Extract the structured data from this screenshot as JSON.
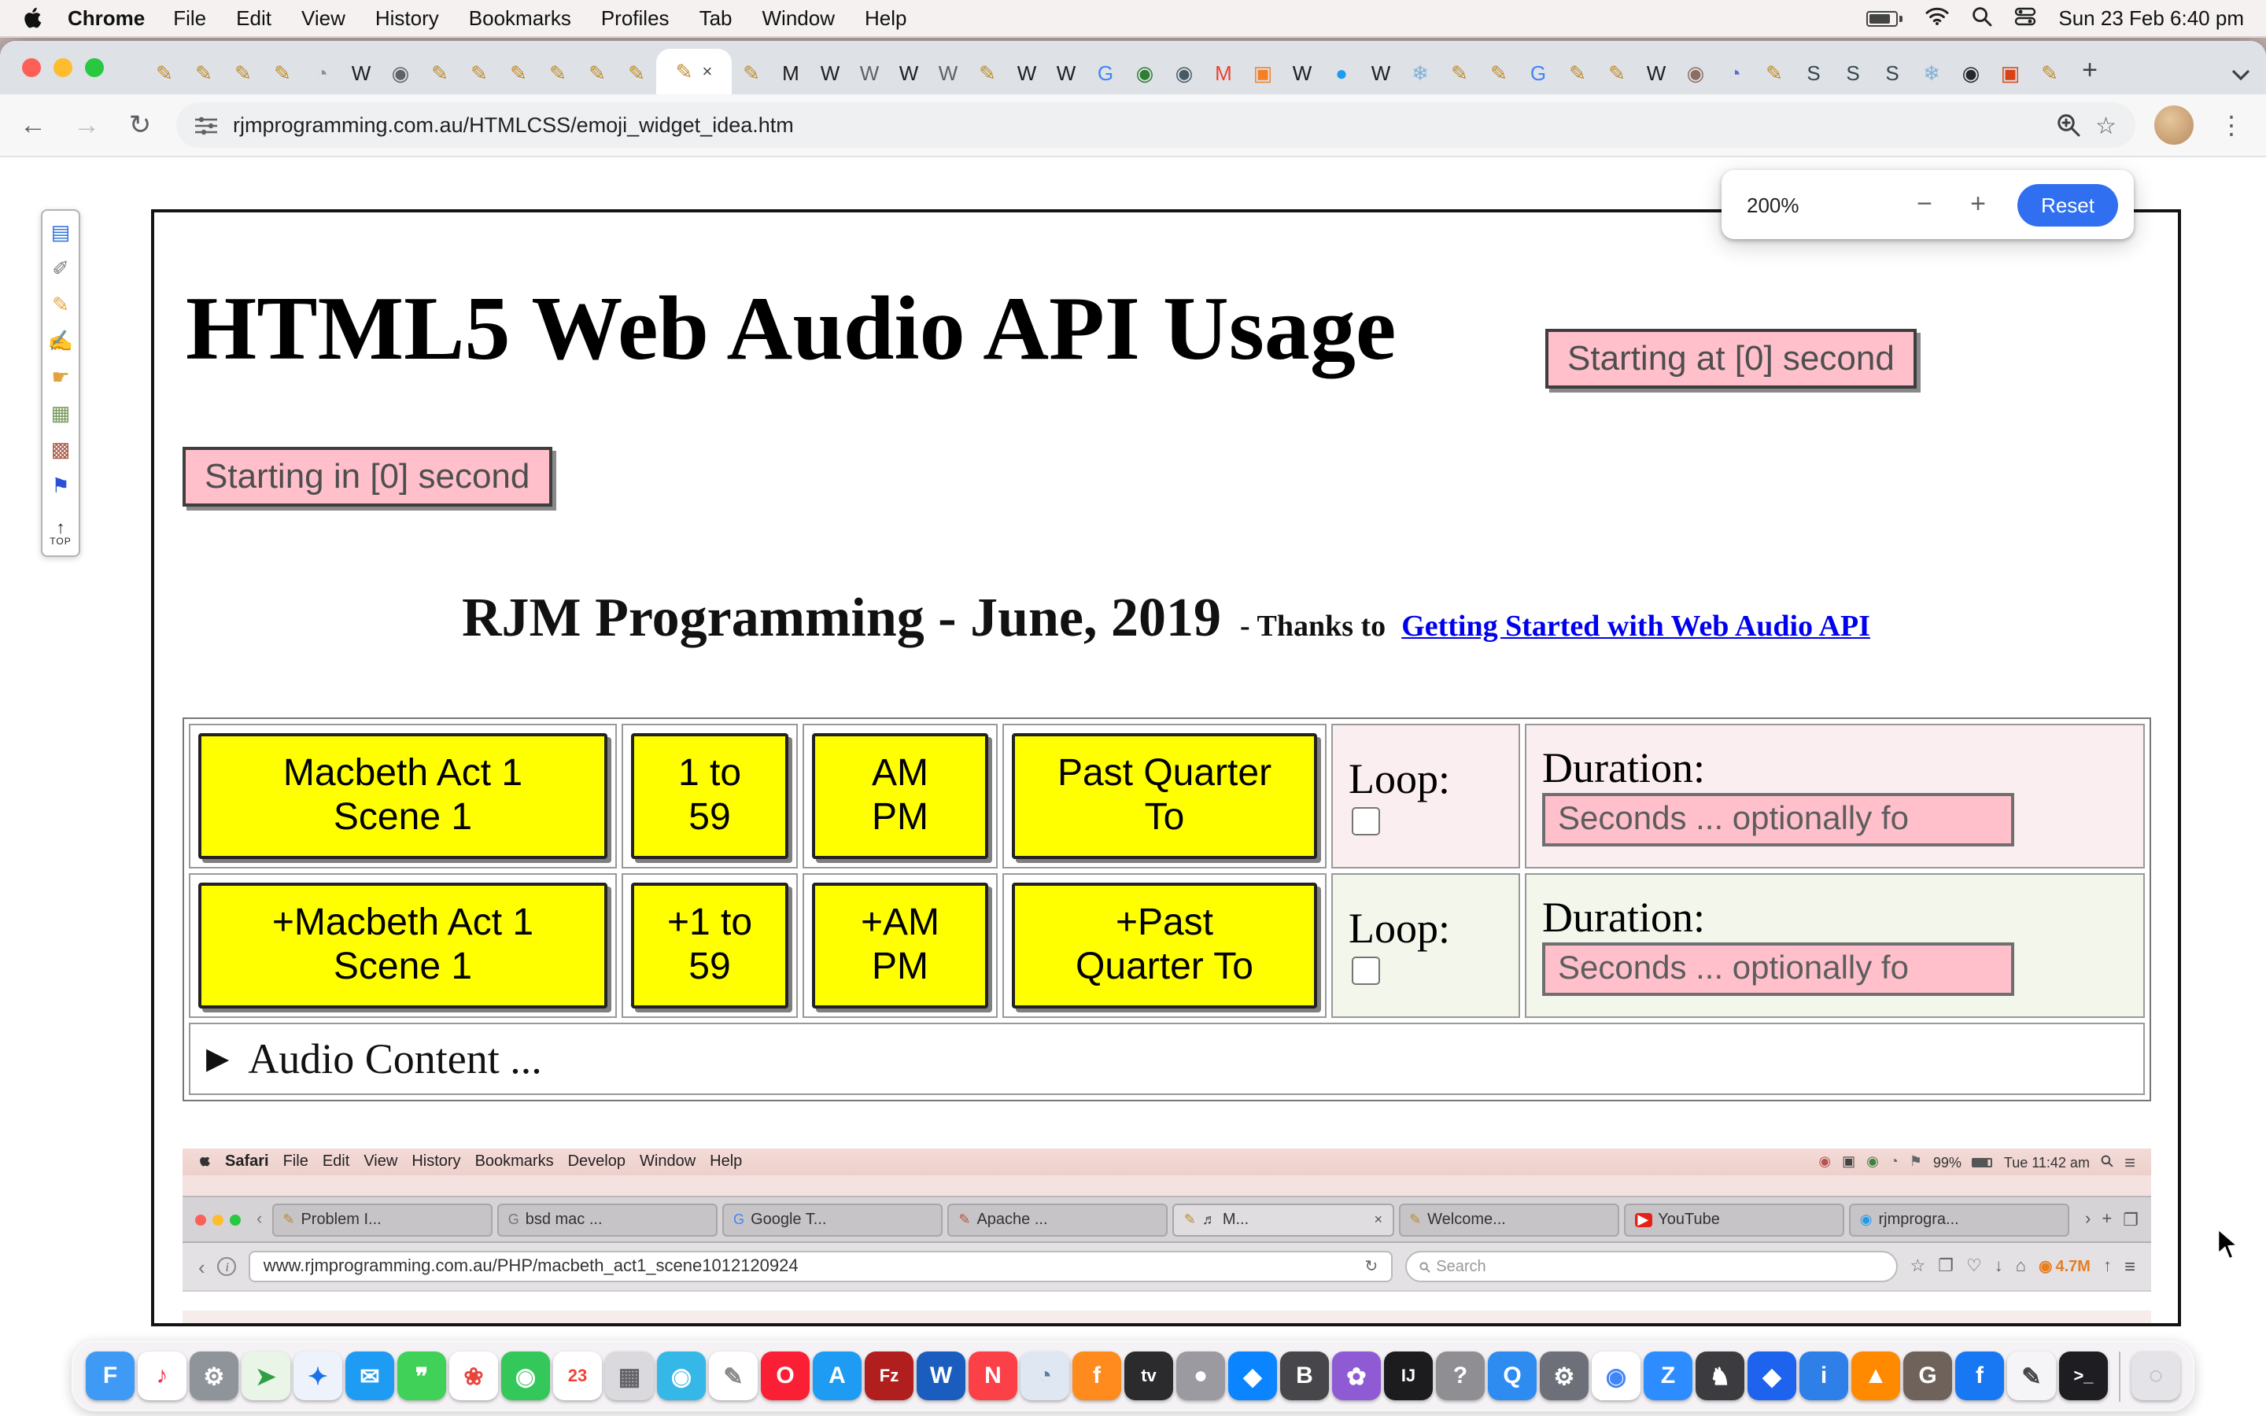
{
  "menubar": {
    "app": "Chrome",
    "items": [
      "File",
      "Edit",
      "View",
      "History",
      "Bookmarks",
      "Profiles",
      "Tab",
      "Window",
      "Help"
    ],
    "clock": "Sun 23 Feb 6:40 pm"
  },
  "tabstrip": {
    "favicons_before": [
      {
        "g": "✎",
        "c": "#c08a28"
      },
      {
        "g": "✎",
        "c": "#c08a28"
      },
      {
        "g": "✎",
        "c": "#c08a28"
      },
      {
        "g": "✎",
        "c": "#c08a28"
      },
      {
        "g": "◔",
        "c": "#8a8f98"
      },
      {
        "g": "W",
        "c": "#202124"
      },
      {
        "g": "◉",
        "c": "#5f6368"
      },
      {
        "g": "✎",
        "c": "#c08a28"
      },
      {
        "g": "✎",
        "c": "#c08a28"
      },
      {
        "g": "✎",
        "c": "#c08a28"
      },
      {
        "g": "✎",
        "c": "#c08a28"
      },
      {
        "g": "✎",
        "c": "#c08a28"
      },
      {
        "g": "✎",
        "c": "#c08a28"
      }
    ],
    "active": {
      "g": "✎",
      "c": "#c08a28"
    },
    "close": "×",
    "favicons_after": [
      {
        "g": "✎",
        "c": "#c08a28"
      },
      {
        "g": "M",
        "c": "#1a1a1a"
      },
      {
        "g": "W",
        "c": "#202124"
      },
      {
        "g": "W",
        "c": "#5f6368"
      },
      {
        "g": "W",
        "c": "#202124"
      },
      {
        "g": "W",
        "c": "#5f6368"
      },
      {
        "g": "✎",
        "c": "#c08a28"
      },
      {
        "g": "W",
        "c": "#202124"
      },
      {
        "g": "W",
        "c": "#202124"
      },
      {
        "g": "G",
        "c": "#4285f4"
      },
      {
        "g": "◉",
        "c": "#2e7d32"
      },
      {
        "g": "◉",
        "c": "#455a64"
      },
      {
        "g": "M",
        "c": "#ea4335"
      },
      {
        "g": "▣",
        "c": "#f48024"
      },
      {
        "g": "W",
        "c": "#202124"
      },
      {
        "g": "●",
        "c": "#1d9bf0"
      },
      {
        "g": "W",
        "c": "#202124"
      },
      {
        "g": "❄",
        "c": "#7fb1d8"
      },
      {
        "g": "✎",
        "c": "#c08a28"
      },
      {
        "g": "✎",
        "c": "#c08a28"
      },
      {
        "g": "G",
        "c": "#4285f4"
      },
      {
        "g": "✎",
        "c": "#c08a28"
      },
      {
        "g": "✎",
        "c": "#c08a28"
      },
      {
        "g": "W",
        "c": "#202124"
      },
      {
        "g": "◉",
        "c": "#8d6e63"
      },
      {
        "g": "◔",
        "c": "#5c6bc0"
      },
      {
        "g": "✎",
        "c": "#c08a28"
      },
      {
        "g": "S",
        "c": "#37474f"
      },
      {
        "g": "S",
        "c": "#37474f"
      },
      {
        "g": "S",
        "c": "#37474f"
      },
      {
        "g": "❄",
        "c": "#7fb1d8"
      },
      {
        "g": "◉",
        "c": "#24292e"
      },
      {
        "g": "▣",
        "c": "#d84315"
      },
      {
        "g": "✎",
        "c": "#c08a28"
      }
    ],
    "new_tab": "+"
  },
  "toolbar": {
    "back": "←",
    "forward": "→",
    "reload": "↻",
    "url": "rjmprogramming.com.au/HTMLCSS/emoji_widget_idea.htm",
    "star": "☆",
    "menu": "⋮"
  },
  "zoom_popup": {
    "level": "200%",
    "minus": "−",
    "plus": "+",
    "reset": "Reset"
  },
  "sidebar": {
    "icons": [
      {
        "n": "books",
        "g": "▤",
        "c": "#2e6fdb"
      },
      {
        "n": "paint-tool",
        "g": "✐",
        "c": "#7a7a7a"
      },
      {
        "n": "pencil",
        "g": "✎",
        "c": "#e8a33d"
      },
      {
        "n": "runner",
        "g": "✍",
        "c": "#c77d3a"
      },
      {
        "n": "pointing-hand",
        "g": "☛",
        "c": "#e0a23e"
      },
      {
        "n": "picture-frame",
        "g": "▦",
        "c": "#76985c"
      },
      {
        "n": "painting",
        "g": "▩",
        "c": "#a85a46"
      },
      {
        "n": "flag",
        "g": "⚑",
        "c": "#2b4fd8"
      }
    ],
    "top_arrow": "↑",
    "top_label": "TOP"
  },
  "page": {
    "h1": "HTML5 Web Audio API Usage",
    "starting_at": "Starting at [0] second",
    "starting_in": "Starting in [0] second",
    "byline_main": "RJM Programming - June, 2019",
    "byline_thanks": "- Thanks to",
    "byline_link": "Getting Started with Web Audio API",
    "audio_summary": "Audio Content ...",
    "disclosure_marker": "▶",
    "table": {
      "rows": [
        {
          "buttons": [
            "Macbeth Act 1\nScene 1",
            "1 to\n59",
            "AM\nPM",
            "Past Quarter\nTo"
          ],
          "loop_label": "Loop:",
          "duration_label": "Duration:",
          "duration_value": "Seconds ... optionally fo"
        },
        {
          "buttons": [
            "+Macbeth Act 1\nScene 1",
            "+1 to\n59",
            "+AM\nPM",
            "+Past\nQuarter To"
          ],
          "loop_label": "Loop:",
          "duration_label": "Duration:",
          "duration_value": "Seconds ... optionally fo"
        }
      ]
    }
  },
  "inner_screenshot": {
    "menubar": {
      "app": "Safari",
      "items": [
        "File",
        "Edit",
        "View",
        "History",
        "Bookmarks",
        "Develop",
        "Window",
        "Help"
      ],
      "battery": "99%",
      "clock": "Tue 11:42 am"
    },
    "tabs": [
      {
        "title": "Problem I...",
        "fav": "✎",
        "fav_color": "#b98a2e"
      },
      {
        "title": "bsd mac ...",
        "fav": "G",
        "fav_color": "#777777"
      },
      {
        "title": "Google T...",
        "fav": "G",
        "fav_color": "#4285f4"
      },
      {
        "title": "Apache ...",
        "fav": "✎",
        "fav_color": "#b5543c"
      },
      {
        "title": "M...",
        "fav": "✎",
        "fav_color": "#b98a2e",
        "active": true,
        "speaker": "♬",
        "close": "×"
      },
      {
        "title": "Welcome...",
        "fav": "✎",
        "fav_color": "#b98a2e"
      },
      {
        "title": "YouTube",
        "fav": "▶",
        "fav_color": "#ffffff",
        "fav_bg": "#e62117"
      },
      {
        "title": "rjmprogra...",
        "fav": "◉",
        "fav_color": "#1d9bf0"
      }
    ],
    "overflow": "›",
    "new_tab": "+",
    "panel": "❐",
    "back": "‹",
    "info": "i",
    "url": "www.rjmprogramming.com.au/PHP/macbeth_act1_scene1012120924",
    "reload": "↻",
    "search_placeholder": "Search",
    "toolbar_icons": [
      "☆",
      "❐",
      "♡",
      "↓",
      "⌂"
    ],
    "counter": "4.7M",
    "share": "↑",
    "burger": "≡"
  },
  "dock": {
    "apps": [
      {
        "n": "finder",
        "g": "F",
        "bg": "#3f9af5",
        "fg": "#fff"
      },
      {
        "n": "music",
        "g": "♪",
        "bg": "#ffffff",
        "fg": "#f5314d"
      },
      {
        "n": "settings",
        "g": "⚙",
        "bg": "#8f949b",
        "fg": "#fff"
      },
      {
        "n": "maps",
        "g": "➤",
        "bg": "#e9f5e7",
        "fg": "#2f9e44"
      },
      {
        "n": "safari",
        "g": "✦",
        "bg": "#eef3fb",
        "fg": "#1b72e8"
      },
      {
        "n": "mail",
        "g": "✉",
        "bg": "#1e9cf4",
        "fg": "#fff"
      },
      {
        "n": "messages",
        "g": "❞",
        "bg": "#3fd158",
        "fg": "#fff"
      },
      {
        "n": "photos",
        "g": "❀",
        "bg": "#ffffff",
        "fg": "#e8453c"
      },
      {
        "n": "facetime",
        "g": "◉",
        "bg": "#34c759",
        "fg": "#fff"
      },
      {
        "n": "calendar",
        "g": "23",
        "bg": "#ffffff",
        "fg": "#f24236"
      },
      {
        "n": "launchpad",
        "g": "▦",
        "bg": "#dadade",
        "fg": "#65656a"
      },
      {
        "n": "photo-booth",
        "g": "◉",
        "bg": "#35b7e8",
        "fg": "#fff"
      },
      {
        "n": "textedit",
        "g": "✎",
        "bg": "#ffffff",
        "fg": "#8a8a8e"
      },
      {
        "n": "opera",
        "g": "O",
        "bg": "#fb1f35",
        "fg": "#fff"
      },
      {
        "n": "app-store",
        "g": "A",
        "bg": "#1e9cf4",
        "fg": "#fff"
      },
      {
        "n": "filezilla",
        "g": "Fz",
        "bg": "#b01e1e",
        "fg": "#fff"
      },
      {
        "n": "word",
        "g": "W",
        "bg": "#1a5dbe",
        "fg": "#fff"
      },
      {
        "n": "news",
        "g": "N",
        "bg": "#fb4048",
        "fg": "#fff"
      },
      {
        "n": "preview",
        "g": "◔",
        "bg": "#dfe8f2",
        "fg": "#5a7ca8"
      },
      {
        "n": "firefox",
        "g": "f",
        "bg": "#ff8a1e",
        "fg": "#fff"
      },
      {
        "n": "apple-tv",
        "g": "tv",
        "bg": "#2b2b2e",
        "fg": "#fff"
      },
      {
        "n": "gray-app",
        "g": "●",
        "bg": "#9a9aa0",
        "fg": "#fff"
      },
      {
        "n": "blue-app",
        "g": "◆",
        "bg": "#0a84ff",
        "fg": "#fff"
      },
      {
        "n": "bbedit",
        "g": "B",
        "bg": "#47474b",
        "fg": "#fff"
      },
      {
        "n": "purple-app",
        "g": "✿",
        "bg": "#8e5bd4",
        "fg": "#fff"
      },
      {
        "n": "intellij",
        "g": "IJ",
        "bg": "#1c1c1e",
        "fg": "#fff"
      },
      {
        "n": "help",
        "g": "?",
        "bg": "#8e8e93",
        "fg": "#fff"
      },
      {
        "n": "quicktime",
        "g": "Q",
        "bg": "#2e8cf0",
        "fg": "#fff"
      },
      {
        "n": "utilities",
        "g": "⚙",
        "bg": "#6d7078",
        "fg": "#fff"
      },
      {
        "n": "chrome",
        "g": "◉",
        "bg": "#ffffff",
        "fg": "#4285f4"
      },
      {
        "n": "zoom",
        "g": "Z",
        "bg": "#2d8cff",
        "fg": "#fff"
      },
      {
        "n": "dark-app",
        "g": "♞",
        "bg": "#3c3c40",
        "fg": "#fff"
      },
      {
        "n": "docker",
        "g": "◆",
        "bg": "#1d63ed",
        "fg": "#fff"
      },
      {
        "n": "info-app",
        "g": "i",
        "bg": "#2f7fe8",
        "fg": "#fff"
      },
      {
        "n": "vlc",
        "g": "▲",
        "bg": "#ff8a00",
        "fg": "#fff"
      },
      {
        "n": "gimp",
        "g": "G",
        "bg": "#6f625a",
        "fg": "#fff"
      },
      {
        "n": "facebook",
        "g": "f",
        "bg": "#1877f2",
        "fg": "#fff"
      },
      {
        "n": "pencil-app",
        "g": "✎",
        "bg": "#f5f5f7",
        "fg": "#444"
      },
      {
        "n": "terminal",
        "g": ">_",
        "bg": "#1e1e22",
        "fg": "#fff"
      },
      {
        "n": "trash",
        "g": "◌",
        "bg": "#e3e3e8",
        "fg": "#9a9aa0"
      }
    ]
  }
}
